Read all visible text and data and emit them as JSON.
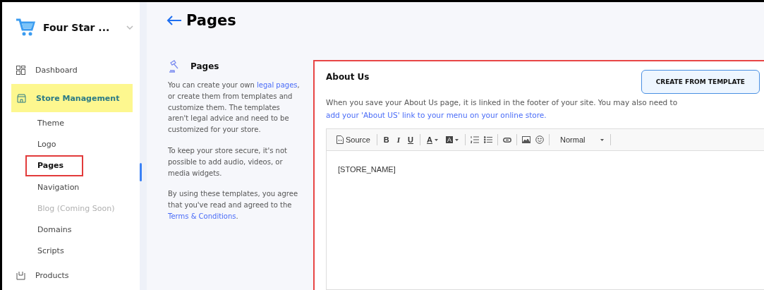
{
  "sidebar": {
    "store_name": "Four Star ...",
    "items": [
      {
        "label": "Dashboard",
        "kind": "top",
        "selected": false,
        "disabled": false
      },
      {
        "label": "Store Management",
        "kind": "top",
        "selected": true,
        "disabled": false
      },
      {
        "label": "Theme",
        "kind": "sub",
        "selected": false,
        "disabled": false
      },
      {
        "label": "Logo",
        "kind": "sub",
        "selected": false,
        "disabled": false
      },
      {
        "label": "Pages",
        "kind": "sub",
        "selected": true,
        "disabled": false
      },
      {
        "label": "Navigation",
        "kind": "sub",
        "selected": false,
        "disabled": false
      },
      {
        "label": "Blog (Coming Soon)",
        "kind": "sub",
        "selected": false,
        "disabled": true
      },
      {
        "label": "Domains",
        "kind": "sub",
        "selected": false,
        "disabled": false
      },
      {
        "label": "Scripts",
        "kind": "sub",
        "selected": false,
        "disabled": false
      },
      {
        "label": "Products",
        "kind": "top",
        "selected": false,
        "disabled": false
      }
    ]
  },
  "page": {
    "title": "Pages"
  },
  "info": {
    "title": "Pages",
    "paragraphs": [
      [
        {
          "text": "You can create your own ",
          "kind": "text"
        },
        {
          "text": "legal pages",
          "kind": "link"
        },
        {
          "text": ", or create them from templates and customize them. The templates aren't legal advice and need to be customized for your store.",
          "kind": "text"
        }
      ],
      [
        {
          "text": "To keep your store secure, it's not possible to add audio, videos, or media widgets.",
          "kind": "text"
        }
      ],
      [
        {
          "text": "By using these templates, you agree that you've read and agreed to the ",
          "kind": "text"
        },
        {
          "text": "Terms & Conditions",
          "kind": "link"
        },
        {
          "text": ".",
          "kind": "text"
        }
      ]
    ]
  },
  "card": {
    "title": "About Us",
    "button": "CREATE FROM TEMPLATE",
    "description": "When you save your About Us page, it is linked in the footer of your site. You may also need to ",
    "link": "add your 'About US' link to your menu on your online store.",
    "toolbar": [
      {
        "kind": "source",
        "label": "Source"
      },
      {
        "kind": "sep"
      },
      {
        "kind": "bold",
        "label": "B"
      },
      {
        "kind": "italic",
        "label": "I"
      },
      {
        "kind": "underline",
        "label": "U"
      },
      {
        "kind": "sep"
      },
      {
        "kind": "textcolor",
        "label": "A"
      },
      {
        "kind": "bgcolor",
        "label": "A"
      },
      {
        "kind": "sep"
      },
      {
        "kind": "ol"
      },
      {
        "kind": "ul"
      },
      {
        "kind": "sep"
      },
      {
        "kind": "link"
      },
      {
        "kind": "sep"
      },
      {
        "kind": "image"
      },
      {
        "kind": "emoji"
      },
      {
        "kind": "sep"
      },
      {
        "kind": "format",
        "label": "Normal"
      },
      {
        "kind": "sep"
      }
    ],
    "content": "[STORE_NAME]"
  }
}
